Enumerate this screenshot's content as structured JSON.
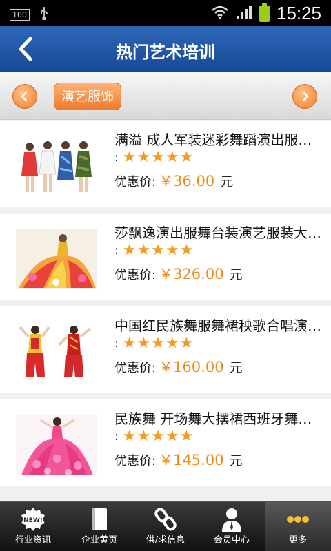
{
  "status_bar": {
    "notif_badge": "100",
    "usb_icon": "usb-icon",
    "time": "15:25"
  },
  "header": {
    "title": "热门艺术培训",
    "back_icon": "chevron-left-icon"
  },
  "category_bar": {
    "selected": "演艺服饰",
    "prev_icon": "arrow-left-icon",
    "next_icon": "arrow-right-icon"
  },
  "products": [
    {
      "title": "满溢 成人军装迷彩舞蹈演出服装女兵演出服",
      "rating_prefix": ":",
      "stars": 5,
      "price_label": "优惠价:",
      "price": "￥36.00",
      "unit": "元"
    },
    {
      "title": "莎飘逸演出服舞台装演艺服装大摆裙",
      "rating_prefix": ":",
      "stars": 5,
      "price_label": "优惠价:",
      "price": "￥326.00",
      "unit": "元"
    },
    {
      "title": "中国红民族舞服舞裙秧歌合唱演出服",
      "rating_prefix": ":",
      "stars": 5,
      "price_label": "优惠价:",
      "price": "￥160.00",
      "unit": "元"
    },
    {
      "title": "民族舞 开场舞大摆裙西班牙舞演出服",
      "rating_prefix": ":",
      "stars": 5,
      "price_label": "优惠价:",
      "price": "￥145.00",
      "unit": "元"
    }
  ],
  "bottom_nav": [
    {
      "label": "行业资讯",
      "icon": "new-badge-icon"
    },
    {
      "label": "企业黄页",
      "icon": "book-icon"
    },
    {
      "label": "供/求信息",
      "icon": "link-icon"
    },
    {
      "label": "会员中心",
      "icon": "user-icon"
    },
    {
      "label": "更多",
      "icon": "more-dots-icon"
    }
  ],
  "colors": {
    "header_blue": "#1f56a6",
    "accent_orange": "#f07e2a",
    "price_orange": "#f08c1a",
    "star_orange": "#f59a1b"
  }
}
